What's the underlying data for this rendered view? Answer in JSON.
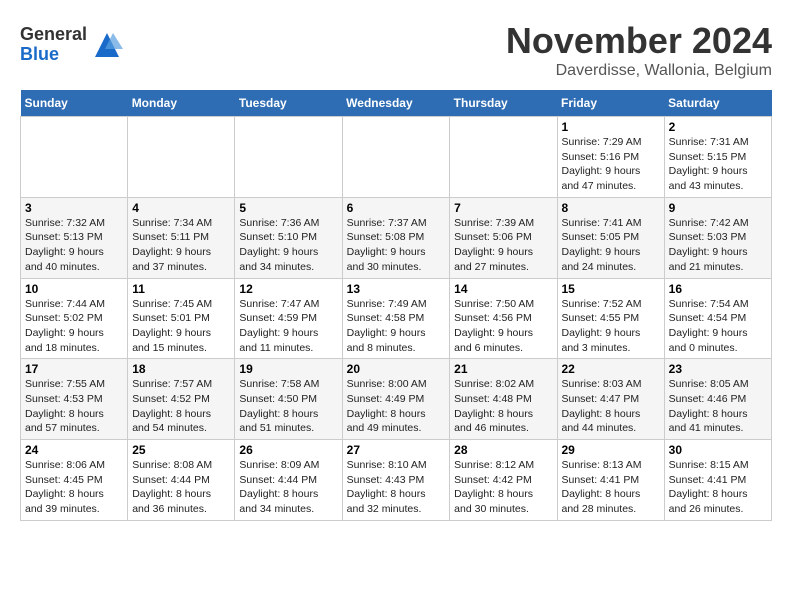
{
  "logo": {
    "general": "General",
    "blue": "Blue"
  },
  "header": {
    "month": "November 2024",
    "location": "Daverdisse, Wallonia, Belgium"
  },
  "weekdays": [
    "Sunday",
    "Monday",
    "Tuesday",
    "Wednesday",
    "Thursday",
    "Friday",
    "Saturday"
  ],
  "weeks": [
    [
      {
        "day": "",
        "info": ""
      },
      {
        "day": "",
        "info": ""
      },
      {
        "day": "",
        "info": ""
      },
      {
        "day": "",
        "info": ""
      },
      {
        "day": "",
        "info": ""
      },
      {
        "day": "1",
        "info": "Sunrise: 7:29 AM\nSunset: 5:16 PM\nDaylight: 9 hours and 47 minutes."
      },
      {
        "day": "2",
        "info": "Sunrise: 7:31 AM\nSunset: 5:15 PM\nDaylight: 9 hours and 43 minutes."
      }
    ],
    [
      {
        "day": "3",
        "info": "Sunrise: 7:32 AM\nSunset: 5:13 PM\nDaylight: 9 hours and 40 minutes."
      },
      {
        "day": "4",
        "info": "Sunrise: 7:34 AM\nSunset: 5:11 PM\nDaylight: 9 hours and 37 minutes."
      },
      {
        "day": "5",
        "info": "Sunrise: 7:36 AM\nSunset: 5:10 PM\nDaylight: 9 hours and 34 minutes."
      },
      {
        "day": "6",
        "info": "Sunrise: 7:37 AM\nSunset: 5:08 PM\nDaylight: 9 hours and 30 minutes."
      },
      {
        "day": "7",
        "info": "Sunrise: 7:39 AM\nSunset: 5:06 PM\nDaylight: 9 hours and 27 minutes."
      },
      {
        "day": "8",
        "info": "Sunrise: 7:41 AM\nSunset: 5:05 PM\nDaylight: 9 hours and 24 minutes."
      },
      {
        "day": "9",
        "info": "Sunrise: 7:42 AM\nSunset: 5:03 PM\nDaylight: 9 hours and 21 minutes."
      }
    ],
    [
      {
        "day": "10",
        "info": "Sunrise: 7:44 AM\nSunset: 5:02 PM\nDaylight: 9 hours and 18 minutes."
      },
      {
        "day": "11",
        "info": "Sunrise: 7:45 AM\nSunset: 5:01 PM\nDaylight: 9 hours and 15 minutes."
      },
      {
        "day": "12",
        "info": "Sunrise: 7:47 AM\nSunset: 4:59 PM\nDaylight: 9 hours and 11 minutes."
      },
      {
        "day": "13",
        "info": "Sunrise: 7:49 AM\nSunset: 4:58 PM\nDaylight: 9 hours and 8 minutes."
      },
      {
        "day": "14",
        "info": "Sunrise: 7:50 AM\nSunset: 4:56 PM\nDaylight: 9 hours and 6 minutes."
      },
      {
        "day": "15",
        "info": "Sunrise: 7:52 AM\nSunset: 4:55 PM\nDaylight: 9 hours and 3 minutes."
      },
      {
        "day": "16",
        "info": "Sunrise: 7:54 AM\nSunset: 4:54 PM\nDaylight: 9 hours and 0 minutes."
      }
    ],
    [
      {
        "day": "17",
        "info": "Sunrise: 7:55 AM\nSunset: 4:53 PM\nDaylight: 8 hours and 57 minutes."
      },
      {
        "day": "18",
        "info": "Sunrise: 7:57 AM\nSunset: 4:52 PM\nDaylight: 8 hours and 54 minutes."
      },
      {
        "day": "19",
        "info": "Sunrise: 7:58 AM\nSunset: 4:50 PM\nDaylight: 8 hours and 51 minutes."
      },
      {
        "day": "20",
        "info": "Sunrise: 8:00 AM\nSunset: 4:49 PM\nDaylight: 8 hours and 49 minutes."
      },
      {
        "day": "21",
        "info": "Sunrise: 8:02 AM\nSunset: 4:48 PM\nDaylight: 8 hours and 46 minutes."
      },
      {
        "day": "22",
        "info": "Sunrise: 8:03 AM\nSunset: 4:47 PM\nDaylight: 8 hours and 44 minutes."
      },
      {
        "day": "23",
        "info": "Sunrise: 8:05 AM\nSunset: 4:46 PM\nDaylight: 8 hours and 41 minutes."
      }
    ],
    [
      {
        "day": "24",
        "info": "Sunrise: 8:06 AM\nSunset: 4:45 PM\nDaylight: 8 hours and 39 minutes."
      },
      {
        "day": "25",
        "info": "Sunrise: 8:08 AM\nSunset: 4:44 PM\nDaylight: 8 hours and 36 minutes."
      },
      {
        "day": "26",
        "info": "Sunrise: 8:09 AM\nSunset: 4:44 PM\nDaylight: 8 hours and 34 minutes."
      },
      {
        "day": "27",
        "info": "Sunrise: 8:10 AM\nSunset: 4:43 PM\nDaylight: 8 hours and 32 minutes."
      },
      {
        "day": "28",
        "info": "Sunrise: 8:12 AM\nSunset: 4:42 PM\nDaylight: 8 hours and 30 minutes."
      },
      {
        "day": "29",
        "info": "Sunrise: 8:13 AM\nSunset: 4:41 PM\nDaylight: 8 hours and 28 minutes."
      },
      {
        "day": "30",
        "info": "Sunrise: 8:15 AM\nSunset: 4:41 PM\nDaylight: 8 hours and 26 minutes."
      }
    ]
  ]
}
